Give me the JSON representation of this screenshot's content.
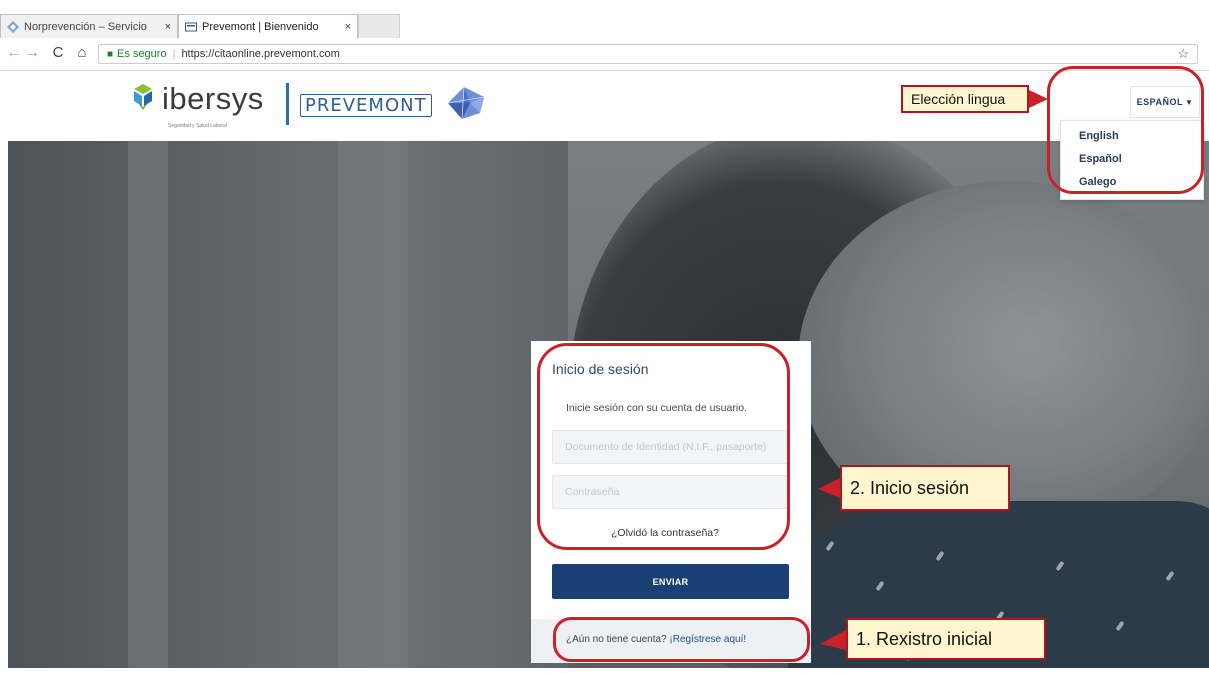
{
  "browser": {
    "tabs": [
      {
        "title": "Norprevención – Servicio",
        "close": "×"
      },
      {
        "title": "Prevemont | Bienvenido",
        "close": "×"
      }
    ],
    "address": {
      "secure_label": "Es seguro",
      "separator": "|",
      "url": "https://citaonline.prevemont.com"
    }
  },
  "header": {
    "ibersys_brand": "ibersys",
    "ibersys_tagline": "Seguridad y Salud Laboral",
    "prevemont_brand": "PREVEMONT",
    "language_button": "ESPAÑOL",
    "languages": [
      "English",
      "Español",
      "Galego"
    ]
  },
  "login": {
    "title": "Inicio de sesión",
    "help": "Inicie sesión con su cuenta de usuario.",
    "document_placeholder": "Documento de Identidad (N.I.F., pasaporte)",
    "password_placeholder": "Contraseña",
    "forgot": "¿Olvidó la contraseña?",
    "submit": "ENVIAR",
    "register_question": "¿Aún no tiene cuenta?",
    "register_link": "¡Regístrese aquí!"
  },
  "annotations": {
    "language": "Elección lingua",
    "login": "2. Inicio sesión",
    "register": "1. Rexistro inicial"
  },
  "colors": {
    "annotation_red": "#c9202a",
    "callout_bg": "#fff6cf",
    "primary_button": "#1a3f72"
  }
}
